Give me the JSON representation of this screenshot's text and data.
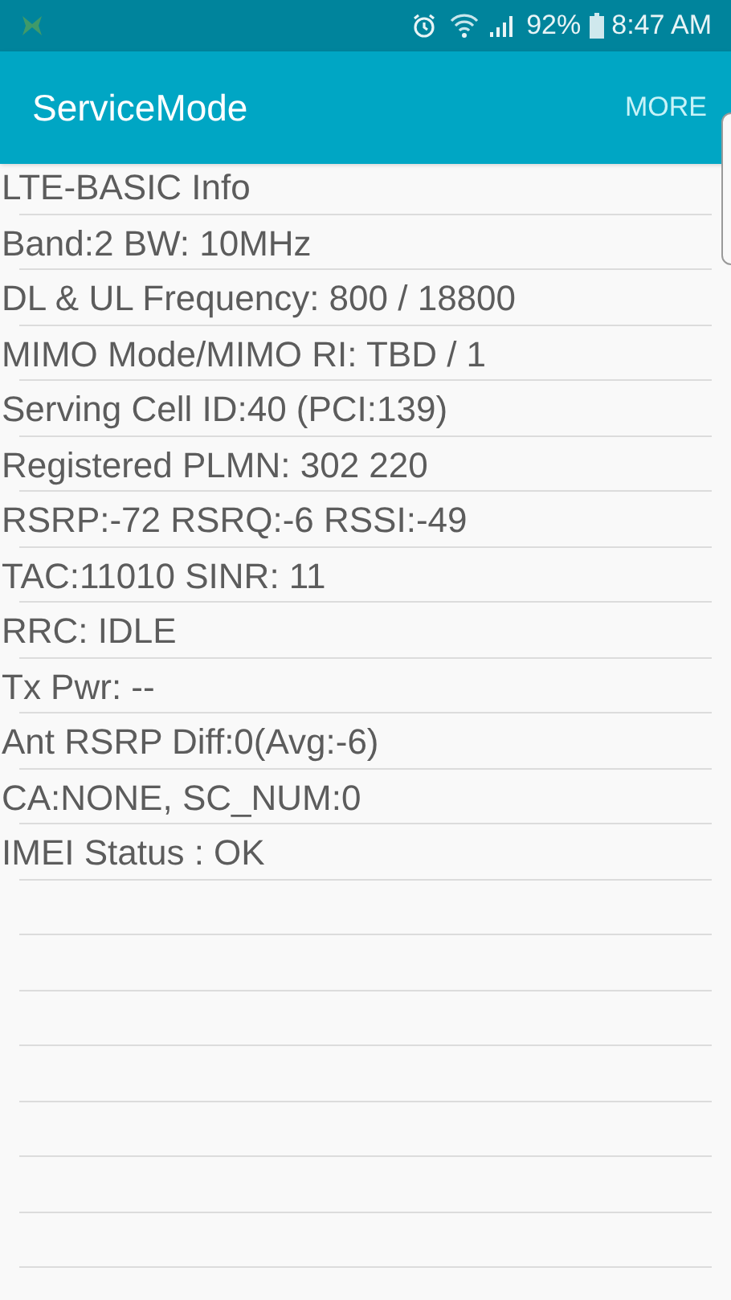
{
  "status_bar": {
    "battery": "92%",
    "time": "8:47 AM"
  },
  "app_bar": {
    "title": "ServiceMode",
    "menu": "MORE"
  },
  "lines": [
    "LTE-BASIC Info",
    "Band:2 BW: 10MHz",
    "DL & UL Frequency: 800 / 18800",
    "MIMO Mode/MIMO RI: TBD / 1",
    "Serving Cell ID:40 (PCI:139)",
    "Registered PLMN: 302 220",
    "RSRP:-72 RSRQ:-6 RSSI:-49",
    "TAC:11010 SINR: 11",
    "RRC: IDLE",
    "Tx Pwr: --",
    "Ant RSRP Diff:0(Avg:-6)",
    "CA:NONE, SC_NUM:0",
    "IMEI Status : OK"
  ]
}
